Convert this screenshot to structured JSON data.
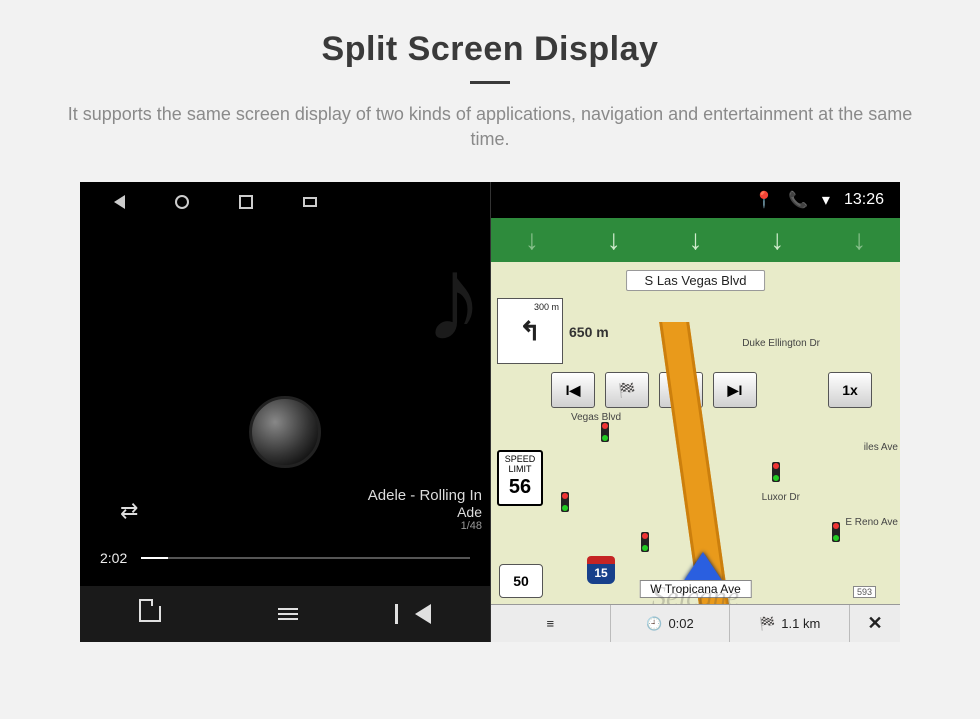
{
  "page": {
    "title": "Split Screen Display",
    "subtitle": "It supports the same screen display of two kinds of applications, navigation and entertainment at the same time."
  },
  "status_bar": {
    "time": "13:26",
    "icons": [
      "location",
      "phone",
      "wifi"
    ]
  },
  "music": {
    "track_title": "Adele - Rolling In",
    "artist": "Ade",
    "index_total": "1/48",
    "elapsed": "2:02",
    "shuffle_glyph": "⇄"
  },
  "nav": {
    "street_top": "S Las Vegas Blvd",
    "street_bottom": "W Tropicana Ave",
    "street_de": "Duke Ellington Dr",
    "streets_right": [
      "iles Ave",
      "E Reno Ave"
    ],
    "vegas_blvd": "Vegas Blvd",
    "luxor": "Luxor Dr",
    "turn_dist_sub": "300 m",
    "dist1": "650 m",
    "speed_limit_label": "SPEED LIMIT",
    "speed_limit_value": "56",
    "shield": "50",
    "i15": "15",
    "speed_btn": "1x",
    "bottom_time": "0:02",
    "bottom_dist": "1.1 km",
    "tag": "593"
  },
  "watermark": "Seicane"
}
